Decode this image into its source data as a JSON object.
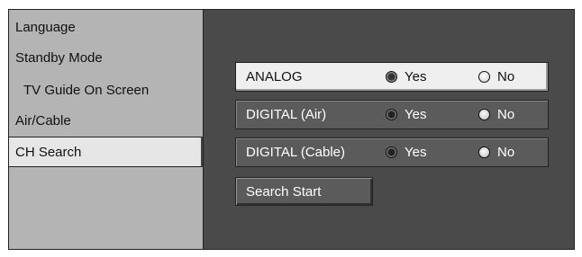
{
  "sidebar": {
    "items": [
      {
        "label": "Language"
      },
      {
        "label": "Standby Mode"
      },
      {
        "label": "TV Guide On Screen"
      },
      {
        "label": "Air/Cable"
      },
      {
        "label": "CH Search"
      }
    ],
    "active_index": 4
  },
  "search": {
    "rows": [
      {
        "label": "ANALOG",
        "yes_label": "Yes",
        "no_label": "No",
        "selected": "Yes",
        "highlighted": true
      },
      {
        "label": "DIGITAL (Air)",
        "yes_label": "Yes",
        "no_label": "No",
        "selected": "Yes",
        "highlighted": false
      },
      {
        "label": "DIGITAL (Cable)",
        "yes_label": "Yes",
        "no_label": "No",
        "selected": "Yes",
        "highlighted": false
      }
    ],
    "start_label": "Search Start"
  },
  "colors": {
    "panel_bg": "#4a4a4a",
    "sidebar_bg": "#b4b4b4",
    "highlight_bg": "#efefef"
  }
}
